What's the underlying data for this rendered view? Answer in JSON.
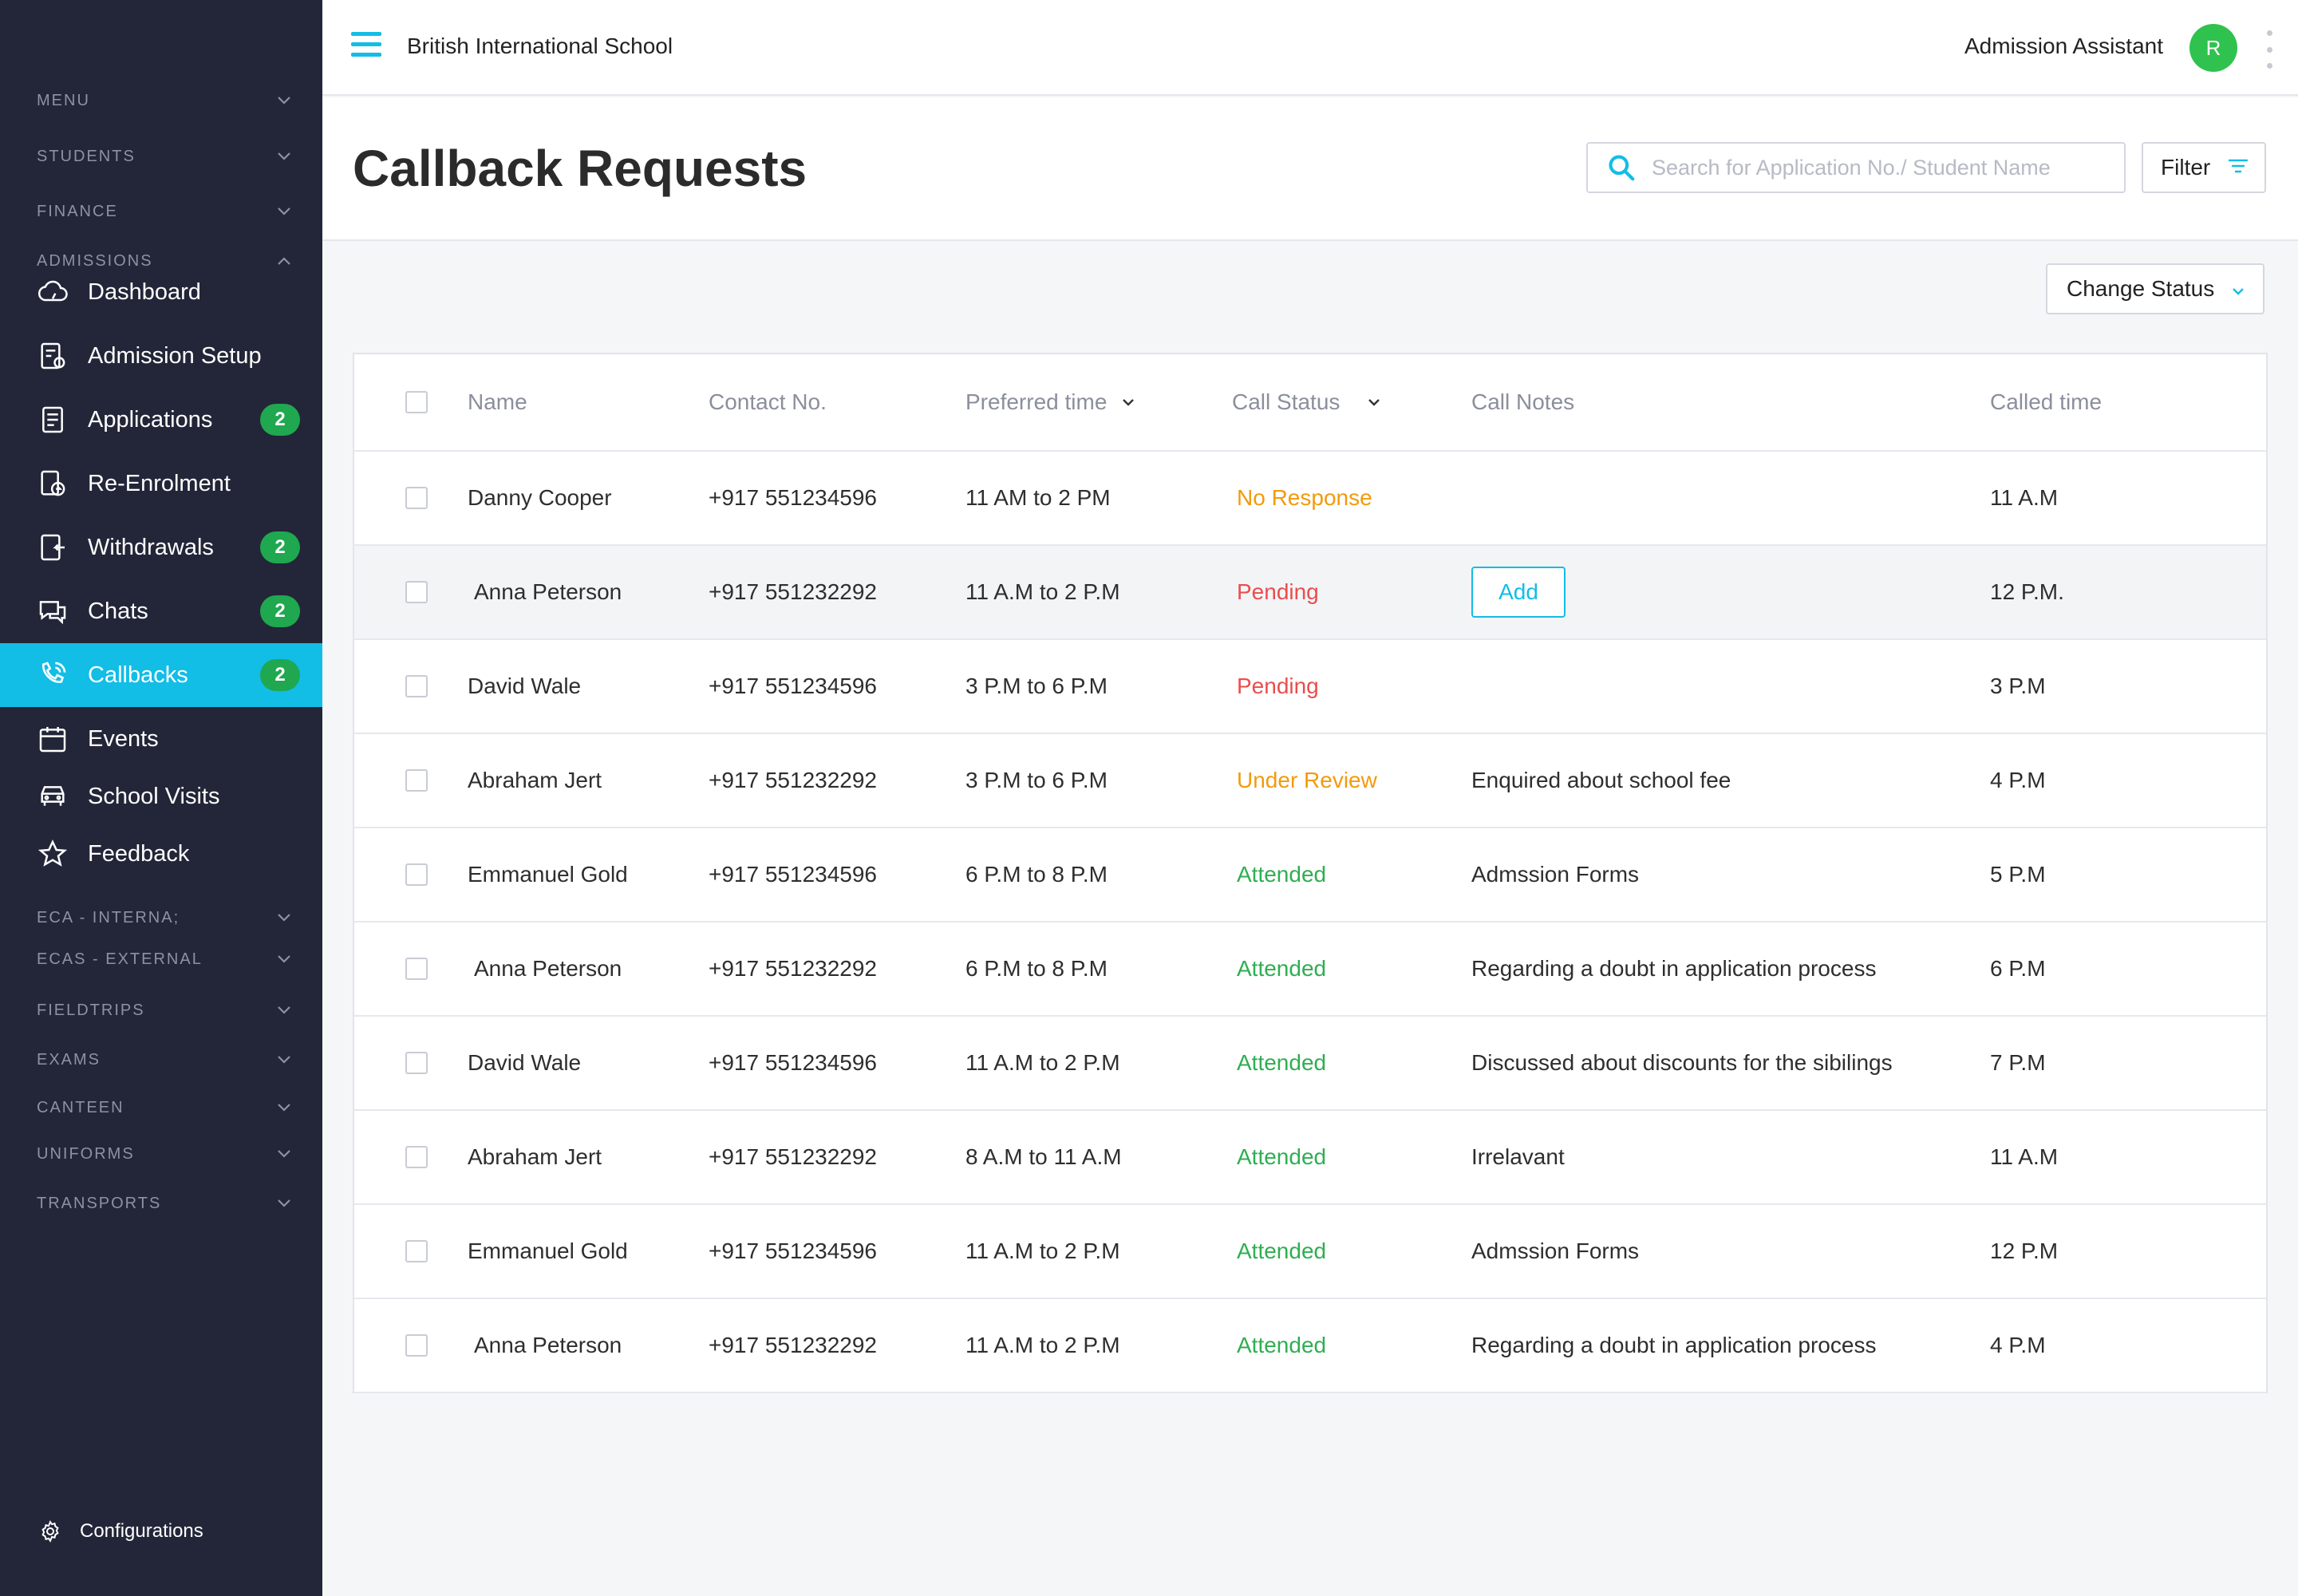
{
  "colors": {
    "sidebar_bg": "#232638",
    "accent": "#12bde6",
    "badge_green": "#1fa84f",
    "status_orange": "#f29a0d",
    "status_red": "#ea4d4d",
    "status_green": "#2fae52"
  },
  "topbar": {
    "school_name": "British International School",
    "role": "Admission Assistant",
    "avatar_initial": "R"
  },
  "sidebar": {
    "sections_top": [
      {
        "label": "MENU"
      },
      {
        "label": "STUDENTS"
      },
      {
        "label": "FINANCE"
      },
      {
        "label": "ADMISSIONS"
      }
    ],
    "items": [
      {
        "label": "Dashboard",
        "icon": "dashboard-icon"
      },
      {
        "label": "Admission Setup",
        "icon": "admission-setup-icon"
      },
      {
        "label": "Applications",
        "icon": "applications-icon",
        "badge": "2"
      },
      {
        "label": "Re-Enrolment",
        "icon": "re-enrolment-icon"
      },
      {
        "label": "Withdrawals",
        "icon": "withdrawals-icon",
        "badge": "2"
      },
      {
        "label": "Chats",
        "icon": "chats-icon",
        "badge": "2"
      },
      {
        "label": "Callbacks",
        "icon": "callbacks-icon",
        "badge": "2",
        "active": true
      },
      {
        "label": "Events",
        "icon": "events-icon"
      },
      {
        "label": "School Visits",
        "icon": "school-visits-icon"
      },
      {
        "label": "Feedback",
        "icon": "feedback-icon"
      }
    ],
    "sections_bottom": [
      {
        "label": "ECA - INTERNA;"
      },
      {
        "label": "ECAS - EXTERNAL"
      },
      {
        "label": "FIELDTRIPS"
      },
      {
        "label": "EXAMS"
      },
      {
        "label": "CANTEEN"
      },
      {
        "label": "UNIFORMS"
      },
      {
        "label": "TRANSPORTS"
      }
    ],
    "config_label": "Configurations"
  },
  "page": {
    "title": "Callback Requests",
    "search_placeholder": "Search for Application No./ Student Name",
    "filter_label": "Filter",
    "change_status_label": "Change Status"
  },
  "table": {
    "columns": [
      "Name",
      "Contact No.",
      "Preferred time",
      "Call Status",
      "Call Notes",
      "Called time"
    ],
    "add_label": "Add",
    "rows": [
      {
        "name": "Danny Cooper",
        "contact": "+917 551234596",
        "preferred": "11 AM to 2 PM",
        "status": "No Response",
        "status_color": "#f29a0d",
        "notes": "",
        "called": "11 A.M"
      },
      {
        "name": "Anna Peterson",
        "contact": "+917 551232292",
        "preferred": "11 A.M to 2 P.M",
        "status": "Pending",
        "status_color": "#ea4d4d",
        "notes": "",
        "add": true,
        "called": "12 P.M."
      },
      {
        "name": "David Wale",
        "contact": "+917 551234596",
        "preferred": "3 P.M to 6 P.M",
        "status": "Pending",
        "status_color": "#ea4d4d",
        "notes": "",
        "called": "3 P.M"
      },
      {
        "name": "Abraham Jert",
        "contact": "+917 551232292",
        "preferred": "3 P.M to 6 P.M",
        "status": "Under Review",
        "status_color": "#f29a0d",
        "notes": "Enquired about school fee",
        "called": "4 P.M"
      },
      {
        "name": "Emmanuel Gold",
        "contact": "+917 551234596",
        "preferred": "6 P.M to 8 P.M",
        "status": "Attended",
        "status_color": "#2fae52",
        "notes": "Admssion Forms",
        "called": "5 P.M"
      },
      {
        "name": "Anna Peterson",
        "contact": "+917 551232292",
        "preferred": "6 P.M to 8 P.M",
        "status": "Attended",
        "status_color": "#2fae52",
        "notes": "Regarding a doubt in application process",
        "called": "6 P.M"
      },
      {
        "name": "David Wale",
        "contact": "+917 551234596",
        "preferred": "11 A.M to 2 P.M",
        "status": "Attended",
        "status_color": "#2fae52",
        "notes": "Discussed about discounts for the sibilings",
        "called": "7 P.M"
      },
      {
        "name": "Abraham Jert",
        "contact": "+917 551232292",
        "preferred": "8 A.M to 11 A.M",
        "status": "Attended",
        "status_color": "#2fae52",
        "notes": "Irrelavant",
        "called": "11 A.M"
      },
      {
        "name": "Emmanuel Gold",
        "contact": "+917 551234596",
        "preferred": "11 A.M to 2 P.M",
        "status": "Attended",
        "status_color": "#2fae52",
        "notes": "Admssion Forms",
        "called": "12 P.M"
      },
      {
        "name": "Anna Peterson",
        "contact": "+917 551232292",
        "preferred": "11 A.M to 2 P.M",
        "status": "Attended",
        "status_color": "#2fae52",
        "notes": "Regarding a doubt in application process",
        "called": "4 P.M"
      }
    ]
  }
}
